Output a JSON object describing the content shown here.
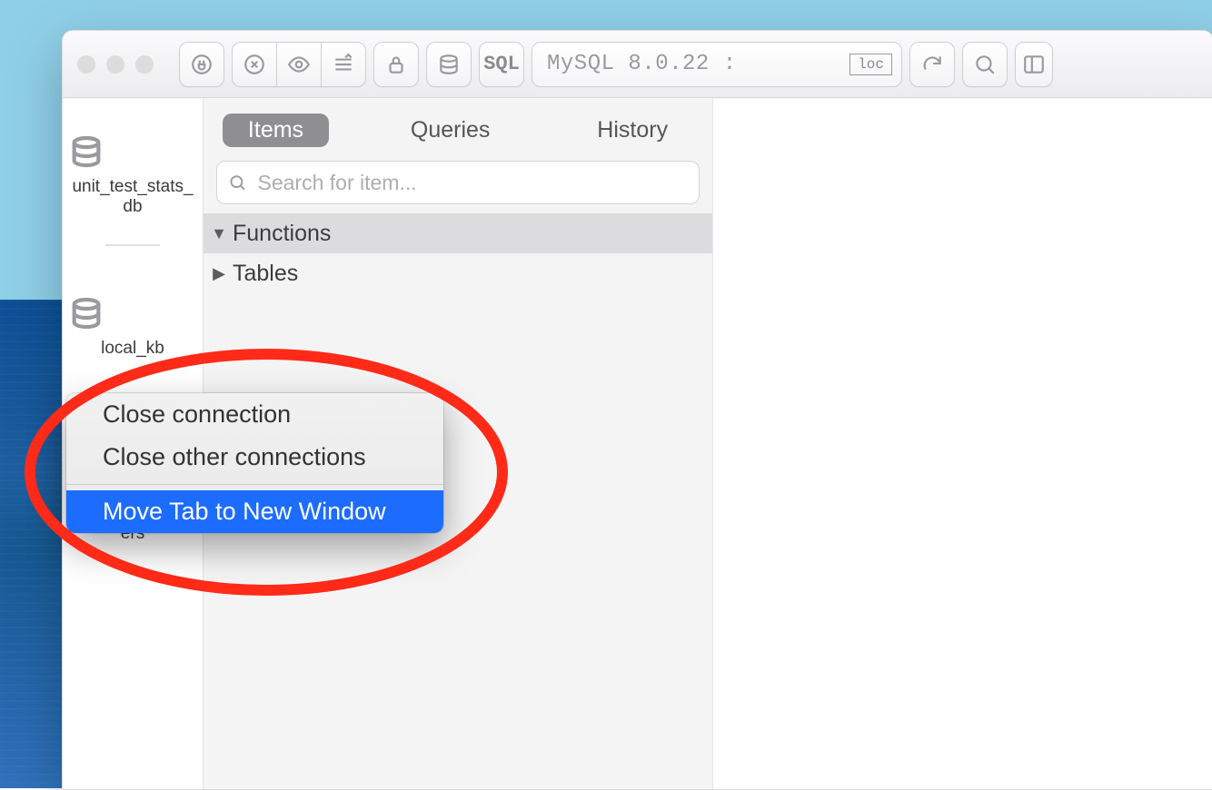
{
  "toolbar": {
    "sql_label": "SQL",
    "connection_string": "MySQL 8.0.22 :",
    "loc_badge": "loc"
  },
  "sidebar": {
    "items": [
      {
        "name": "unit_test_stats_db",
        "active": false
      },
      {
        "name": "local_kb",
        "active": false
      },
      {
        "name": "fullstats_gumoffers",
        "active": true
      }
    ]
  },
  "center": {
    "tabs": [
      {
        "label": "Items",
        "active": true
      },
      {
        "label": "Queries",
        "active": false
      },
      {
        "label": "History",
        "active": false
      }
    ],
    "search_placeholder": "Search for item...",
    "tree": {
      "functions_label": "Functions",
      "tables_label": "Tables"
    }
  },
  "context_menu": {
    "close_connection": "Close connection",
    "close_other_connections": "Close other connections",
    "move_tab": "Move Tab to New Window"
  }
}
